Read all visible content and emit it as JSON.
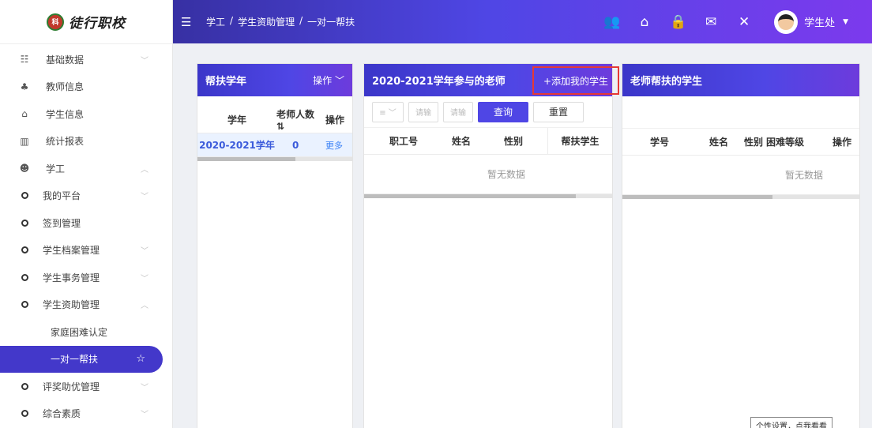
{
  "logo": {
    "emblem": "科",
    "text": "徒行职校"
  },
  "sidebar": {
    "items": [
      {
        "icon": "☷",
        "label": "基础数据",
        "arrow": "﹀"
      },
      {
        "icon": "♣",
        "label": "教师信息",
        "arrow": ""
      },
      {
        "icon": "⌂",
        "label": "学生信息",
        "arrow": ""
      },
      {
        "icon": "▥",
        "label": "统计报表",
        "arrow": ""
      },
      {
        "icon": "☻",
        "label": "学工",
        "arrow": "︿"
      },
      {
        "label": "我的平台",
        "arrow": "﹀"
      },
      {
        "label": "签到管理",
        "arrow": ""
      },
      {
        "label": "学生档案管理",
        "arrow": "﹀"
      },
      {
        "label": "学生事务管理",
        "arrow": "﹀"
      },
      {
        "label": "学生资助管理",
        "arrow": "︿"
      },
      {
        "label": "家庭困难认定"
      },
      {
        "label": "一对一帮扶",
        "star": "☆"
      },
      {
        "label": "评奖助优管理",
        "arrow": "﹀"
      },
      {
        "label": "综合素质",
        "arrow": "﹀"
      }
    ]
  },
  "header": {
    "menu_icon": "☰",
    "breadcrumb": [
      "学工",
      "/",
      "学生资助管理",
      "/",
      "一对一帮扶"
    ],
    "icons": [
      "👥",
      "⌂",
      "🔒",
      "✉",
      "✕"
    ],
    "username": "学生处",
    "caret": "▼"
  },
  "panel1": {
    "title": "帮扶学年",
    "action": "操作 ﹀",
    "columns": [
      "学年",
      "老师人数 ⇅",
      "操作"
    ],
    "rows": [
      {
        "year": "2020-2021学年",
        "count": "0",
        "op": "更多"
      }
    ]
  },
  "panel2": {
    "title": "2020-2021学年参与的老师",
    "add_button": "+添加我的学生",
    "toolbar": {
      "select": "≡ ﹀",
      "input1": "请输",
      "input2": "请输",
      "query": "查询",
      "reset": "重置"
    },
    "columns": [
      "职工号",
      "姓名",
      "性别",
      "帮扶学生"
    ],
    "empty": "暂无数据"
  },
  "panel3": {
    "title": "老师帮扶的学生",
    "columns": [
      "学号",
      "姓名",
      "性别",
      "困难等级",
      "操作"
    ],
    "empty": "暂无数据"
  },
  "tooltip": "个性设置，点我看看"
}
